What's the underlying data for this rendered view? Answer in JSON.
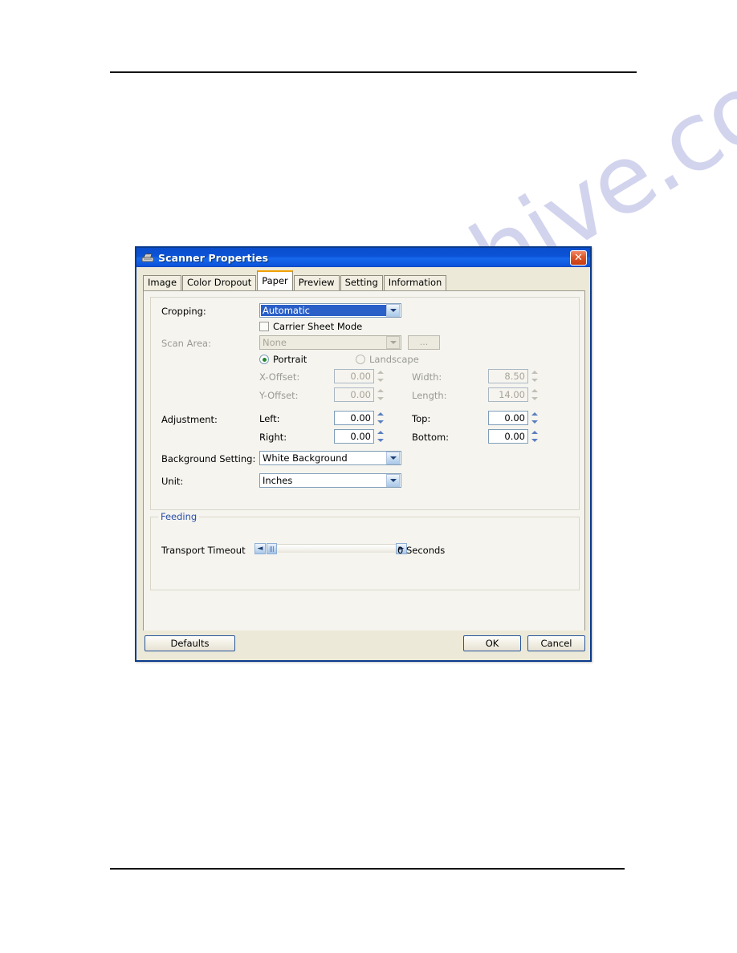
{
  "page": {
    "watermark": "manualshive.com"
  },
  "dialog": {
    "title": "Scanner Properties",
    "title_icon": "scanner-icon",
    "close_label": "✕",
    "tabs": [
      {
        "label": "Image",
        "active": false
      },
      {
        "label": "Color Dropout",
        "active": false
      },
      {
        "label": "Paper",
        "active": true
      },
      {
        "label": "Preview",
        "active": false
      },
      {
        "label": "Setting",
        "active": false
      },
      {
        "label": "Information",
        "active": false
      }
    ],
    "paper": {
      "cropping": {
        "label": "Cropping:",
        "value": "Automatic"
      },
      "carrier_sheet_mode": {
        "label": "Carrier Sheet Mode",
        "checked": false
      },
      "scan_area": {
        "label": "Scan Area:",
        "value": "None",
        "browse_label": "...",
        "enabled": false
      },
      "orientation": {
        "portrait_label": "Portrait",
        "landscape_label": "Landscape",
        "selected": "Portrait"
      },
      "offsets": {
        "x_offset_label": "X-Offset:",
        "x_offset_value": "0.00",
        "y_offset_label": "Y-Offset:",
        "y_offset_value": "0.00",
        "width_label": "Width:",
        "width_value": "8.50",
        "length_label": "Length:",
        "length_value": "14.00"
      },
      "adjustment": {
        "label": "Adjustment:",
        "left_label": "Left:",
        "left_value": "0.00",
        "right_label": "Right:",
        "right_value": "0.00",
        "top_label": "Top:",
        "top_value": "0.00",
        "bottom_label": "Bottom:",
        "bottom_value": "0.00"
      },
      "background_setting": {
        "label": "Background Setting:",
        "value": "White Background"
      },
      "unit": {
        "label": "Unit:",
        "value": "Inches"
      },
      "feeding": {
        "legend": "Feeding",
        "transport_timeout_label": "Transport Timeout",
        "transport_timeout_value": "0 Seconds",
        "slider_left_arrow": "◄",
        "slider_right_arrow": "►"
      }
    },
    "buttons": {
      "defaults": "Defaults",
      "ok": "OK",
      "cancel": "Cancel"
    }
  },
  "colors": {
    "titlebar_blue": "#0b52d6",
    "dialog_face": "#ece9d8",
    "accent_tab": "#f0a000",
    "selection_blue": "#2a5fc8",
    "group_legend": "#2a4ea8",
    "close_red": "#c53c10",
    "watermark": "#b8bbe4"
  }
}
